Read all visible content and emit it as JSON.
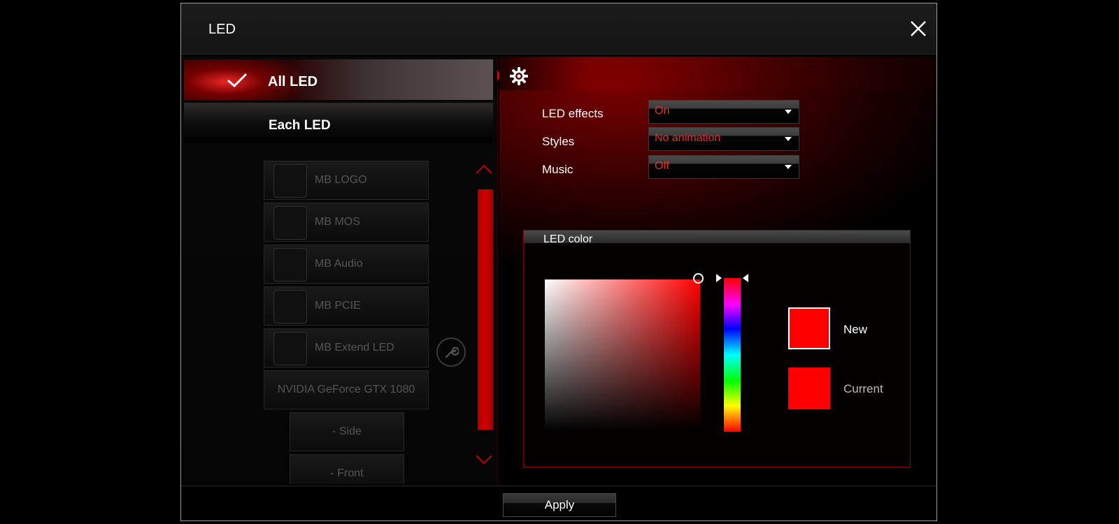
{
  "window": {
    "title": "LED"
  },
  "tabs": {
    "all_led": "All LED",
    "each_led": "Each LED"
  },
  "devices": [
    {
      "label": "MB LOGO"
    },
    {
      "label": "MB MOS"
    },
    {
      "label": "MB Audio"
    },
    {
      "label": "MB PCIE"
    },
    {
      "label": "MB Extend LED"
    },
    {
      "label": "NVIDIA GeForce GTX 1080"
    }
  ],
  "sub_devices": [
    {
      "label": "- Side"
    },
    {
      "label": "- Front"
    }
  ],
  "settings": {
    "led_effects": {
      "label": "LED effects",
      "value": "On"
    },
    "styles": {
      "label": "Styles",
      "value": "No animation"
    },
    "music": {
      "label": "Music",
      "value": "Off"
    }
  },
  "led_color": {
    "title": "LED color",
    "new_label": "New",
    "current_label": "Current",
    "new_color": "#ff0000",
    "current_color": "#ff0000"
  },
  "footer": {
    "apply_label": "Apply"
  },
  "colors": {
    "accent": "#d00000",
    "dropdown_text": "#e03030"
  },
  "icons": [
    "close-icon",
    "check-icon",
    "gear-icon",
    "wrench-icon",
    "chevron-up-icon",
    "chevron-down-icon"
  ]
}
